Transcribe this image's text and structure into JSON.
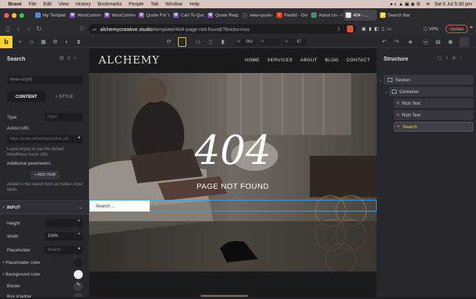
{
  "menubar": {
    "app": "Brave",
    "items": [
      "File",
      "Edit",
      "View",
      "History",
      "Bookmarks",
      "People",
      "Tab",
      "Window",
      "Help"
    ],
    "datetime": "Sat 6 Jul  5:30 pm"
  },
  "tabs": [
    {
      "label": "My Templat",
      "color": "#5a84d8",
      "glyph": ""
    },
    {
      "label": "WooCommer",
      "color": "#7f54b3",
      "glyph": "W"
    },
    {
      "label": "WooCommer",
      "color": "#7f54b3",
      "glyph": "W"
    },
    {
      "label": "Quote For V",
      "color": "#7f54b3",
      "glyph": "W"
    },
    {
      "label": "Cart To Quo",
      "color": "#7f54b3",
      "glyph": "W"
    },
    {
      "label": "Quote Requ",
      "color": "#7f54b3",
      "glyph": "W"
    },
    {
      "label": "view-quote-",
      "color": "#3c3f44",
      "glyph": ""
    },
    {
      "label": "Reddit - Div",
      "color": "#ff4500",
      "glyph": "r"
    },
    {
      "label": "About Us - I",
      "color": "#4e8c72",
      "glyph": ""
    },
    {
      "label": "404 - ...",
      "color": "#e8e8e8",
      "glyph": ""
    },
    {
      "label": "Search Bar",
      "color": "#ffd22d",
      "glyph": "b"
    }
  ],
  "address": {
    "domain": "alchemycreative.studio",
    "path": "/template/404-page-not-found/?bricks=run",
    "vpn": "VPN",
    "update": "Update"
  },
  "toolbar": {
    "width_label": "W",
    "width_value": "992",
    "height_label": "H",
    "height_value": "-",
    "zoom_value": "87"
  },
  "left_panel": {
    "title": "Search",
    "element_id": "#brxe-xnjmfj",
    "tab_content": "CONTENT",
    "tab_style": "+ STYLE",
    "type_label": "Type",
    "type_value": "Input",
    "action_label": "Action URL",
    "action_placeholder": "https://www.alchemycreative.stu",
    "action_hint": "Leave empty to use the default WordPress home URL.",
    "params_label": "Additional parameters",
    "add_item": "+ ADD ITEM",
    "params_hint": "Added to the search form as hidden input fields.",
    "section_input": "INPUT",
    "height_label": "Height",
    "width_label": "Width",
    "width_value": "100%",
    "placeholder_label": "Placeholder",
    "placeholder_value": "Search ...",
    "placeholder_color_label": "Placeholder color",
    "bg_color_label": "Background color",
    "border_label": "Border",
    "box_shadow_label": "Box shadow"
  },
  "site": {
    "logo": "ALCHEMY",
    "nav": [
      "HOME",
      "SERVICES",
      "ABOUT",
      "BLOG",
      "CONTACT"
    ],
    "code": "404",
    "message": "PAGE NOT FOUND",
    "search_placeholder": "Search ..."
  },
  "structure": {
    "title": "Structure",
    "items": [
      "Section",
      "Container",
      "Rich Text",
      "Rich Text",
      "Search"
    ]
  },
  "colors": {
    "accent": "#ffd22d",
    "selection": "#4aa3d8",
    "update": "#d35a4c"
  }
}
